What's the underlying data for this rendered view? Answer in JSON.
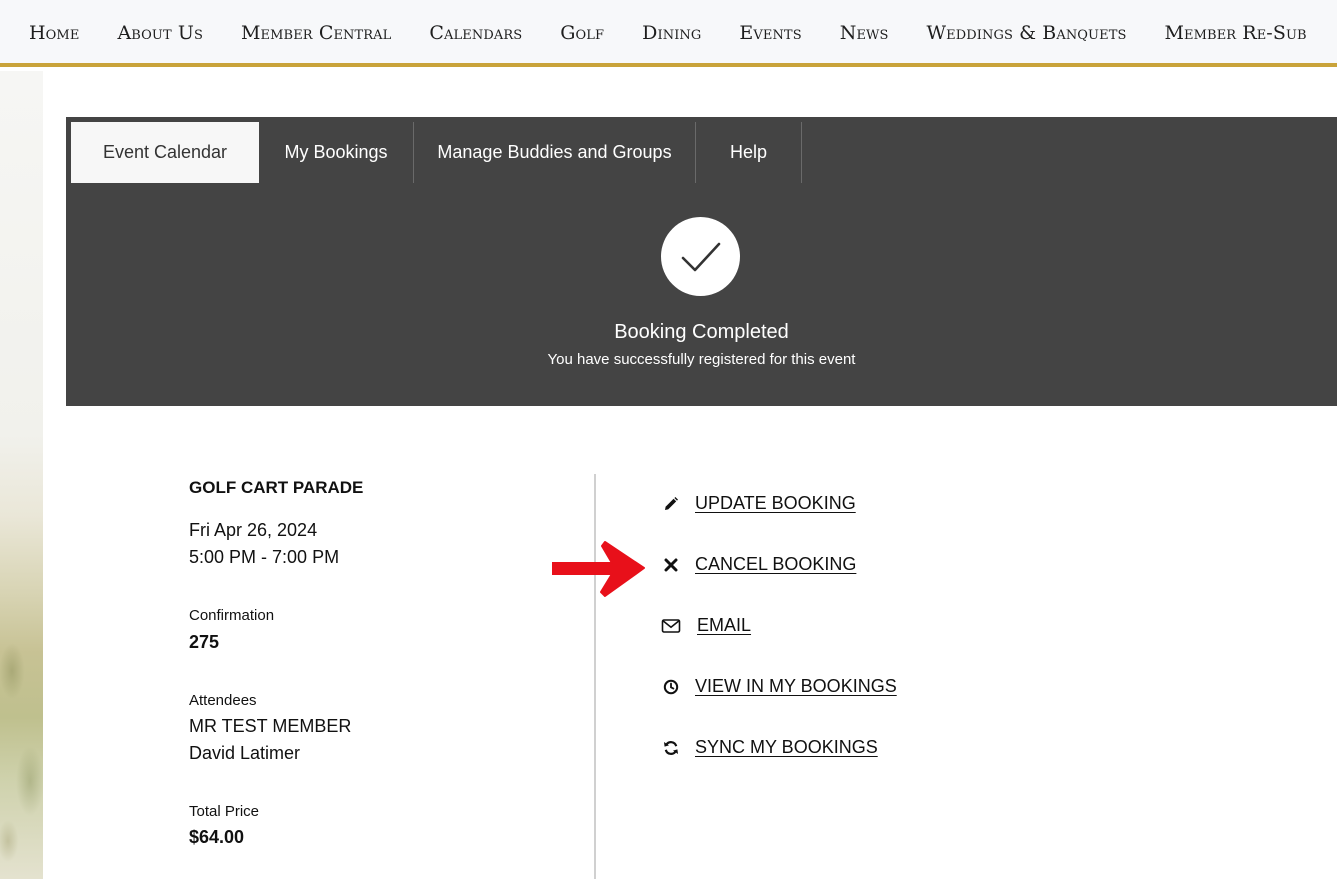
{
  "nav": {
    "items": [
      "Home",
      "About Us",
      "Member Central",
      "Calendars",
      "Golf",
      "Dining",
      "Events",
      "News",
      "Weddings & Banquets",
      "Member Re-Sub"
    ]
  },
  "tabs": [
    {
      "label": "Event Calendar",
      "active": true
    },
    {
      "label": "My Bookings",
      "active": false
    },
    {
      "label": "Manage Buddies and Groups",
      "active": false
    },
    {
      "label": "Help",
      "active": false
    }
  ],
  "status": {
    "title": "Booking Completed",
    "subtitle": "You have successfully registered for this event",
    "icon": "checkmark-icon"
  },
  "booking": {
    "event_name": "GOLF CART PARADE",
    "date": "Fri Apr 26, 2024",
    "time": "5:00 PM - 7:00 PM",
    "confirmation_label": "Confirmation",
    "confirmation_value": "275",
    "attendees_label": "Attendees",
    "attendees": [
      "MR TEST MEMBER",
      "David Latimer"
    ],
    "price_label": "Total Price",
    "price_value": "$64.00"
  },
  "actions": [
    {
      "label": "UPDATE BOOKING",
      "icon": "pencil-icon"
    },
    {
      "label": "CANCEL BOOKING",
      "icon": "x-icon"
    },
    {
      "label": "EMAIL",
      "icon": "envelope-icon"
    },
    {
      "label": "VIEW IN MY BOOKINGS",
      "icon": "clock-icon"
    },
    {
      "label": "SYNC MY BOOKINGS",
      "icon": "refresh-icon"
    }
  ],
  "colors": {
    "accent_gold": "#c9a33a",
    "panel_dark": "#444444",
    "arrow_red": "#e8101a"
  }
}
